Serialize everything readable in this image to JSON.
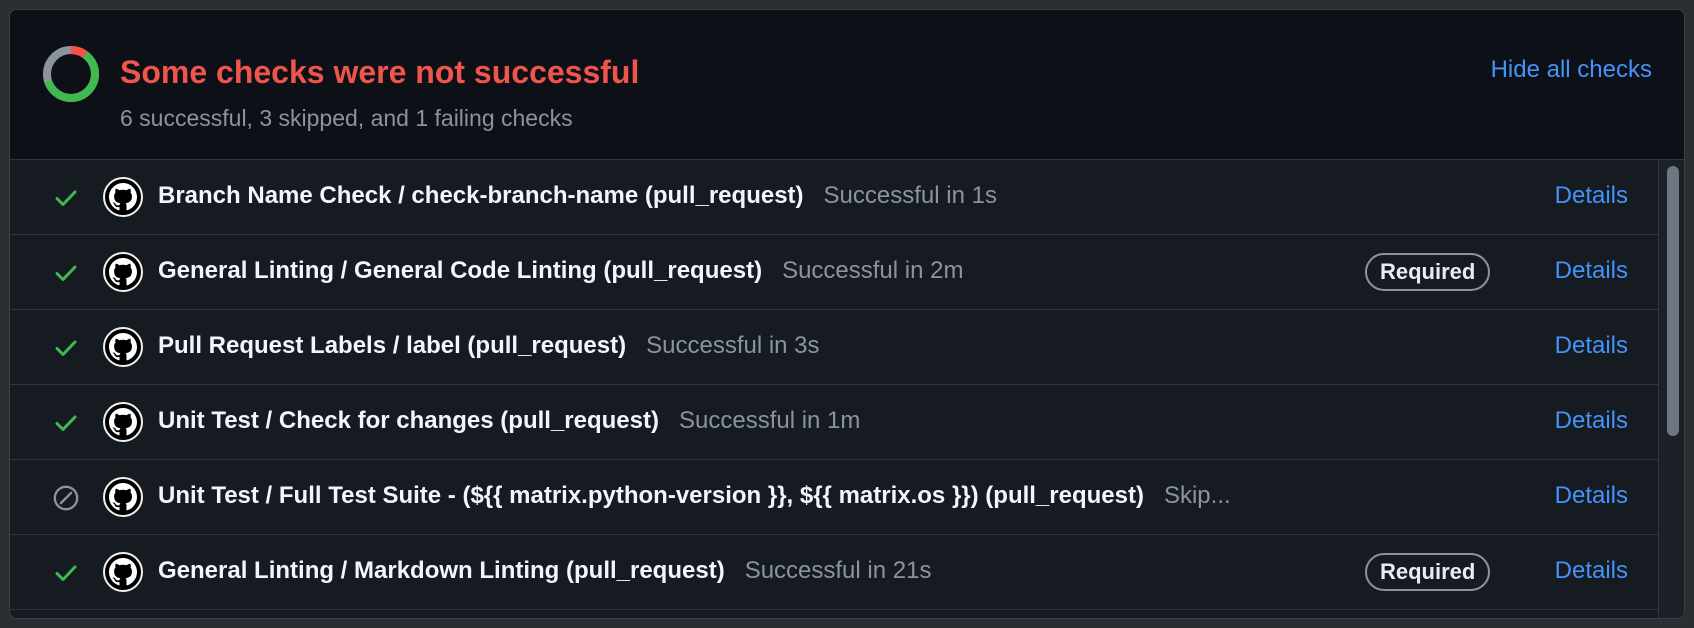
{
  "header": {
    "title": "Some checks were not successful",
    "summary": "6 successful, 3 skipped, and 1 failing checks",
    "hide_label": "Hide all checks",
    "colors": {
      "success": "#3fb950",
      "failure": "#f85149",
      "skipped": "#8b949e"
    }
  },
  "checks": [
    {
      "name": "Branch Name Check / check-branch-name (pull_request)",
      "status_text": "Successful in 1s",
      "state": "success",
      "required": "",
      "details": "Details"
    },
    {
      "name": "General Linting / General Code Linting (pull_request)",
      "status_text": "Successful in 2m",
      "state": "success",
      "required": "Required",
      "details": "Details"
    },
    {
      "name": "Pull Request Labels / label (pull_request)",
      "status_text": "Successful in 3s",
      "state": "success",
      "required": "",
      "details": "Details"
    },
    {
      "name": "Unit Test / Check for changes (pull_request)",
      "status_text": "Successful in 1m",
      "state": "success",
      "required": "",
      "details": "Details"
    },
    {
      "name": "Unit Test / Full Test Suite - (${{ matrix.python-version }}, ${{ matrix.os }}) (pull_request)",
      "status_text": "Skip...",
      "state": "skipped",
      "required": "",
      "details": "Details"
    },
    {
      "name": "General Linting / Markdown Linting (pull_request)",
      "status_text": "Successful in 21s",
      "state": "success",
      "required": "Required",
      "details": "Details"
    }
  ]
}
